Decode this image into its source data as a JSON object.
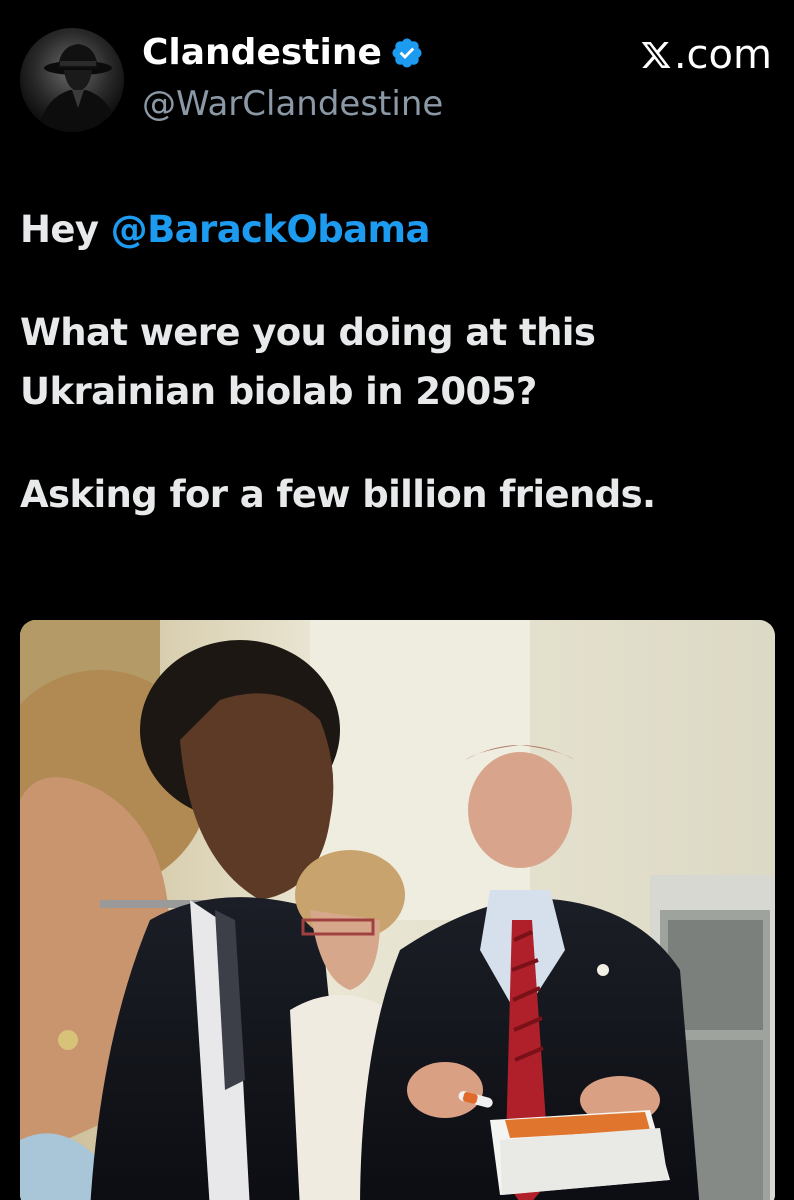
{
  "header": {
    "display_name": "Clandestine",
    "handle": "@WarClandestine",
    "source": ".com",
    "avatar_icon": "avatar-hat-silhouette",
    "verified_icon": "verified-badge-icon",
    "verified_color": "#1d9bf0"
  },
  "tweet": {
    "greeting": "Hey ",
    "mention": "@BarackObama",
    "question_line1": "What were you doing at this",
    "question_line2": "Ukrainian biolab in 2005?",
    "closing": "Asking for a few billion friends.",
    "mention_color": "#1d9bf0"
  },
  "media": {
    "type": "photo"
  }
}
